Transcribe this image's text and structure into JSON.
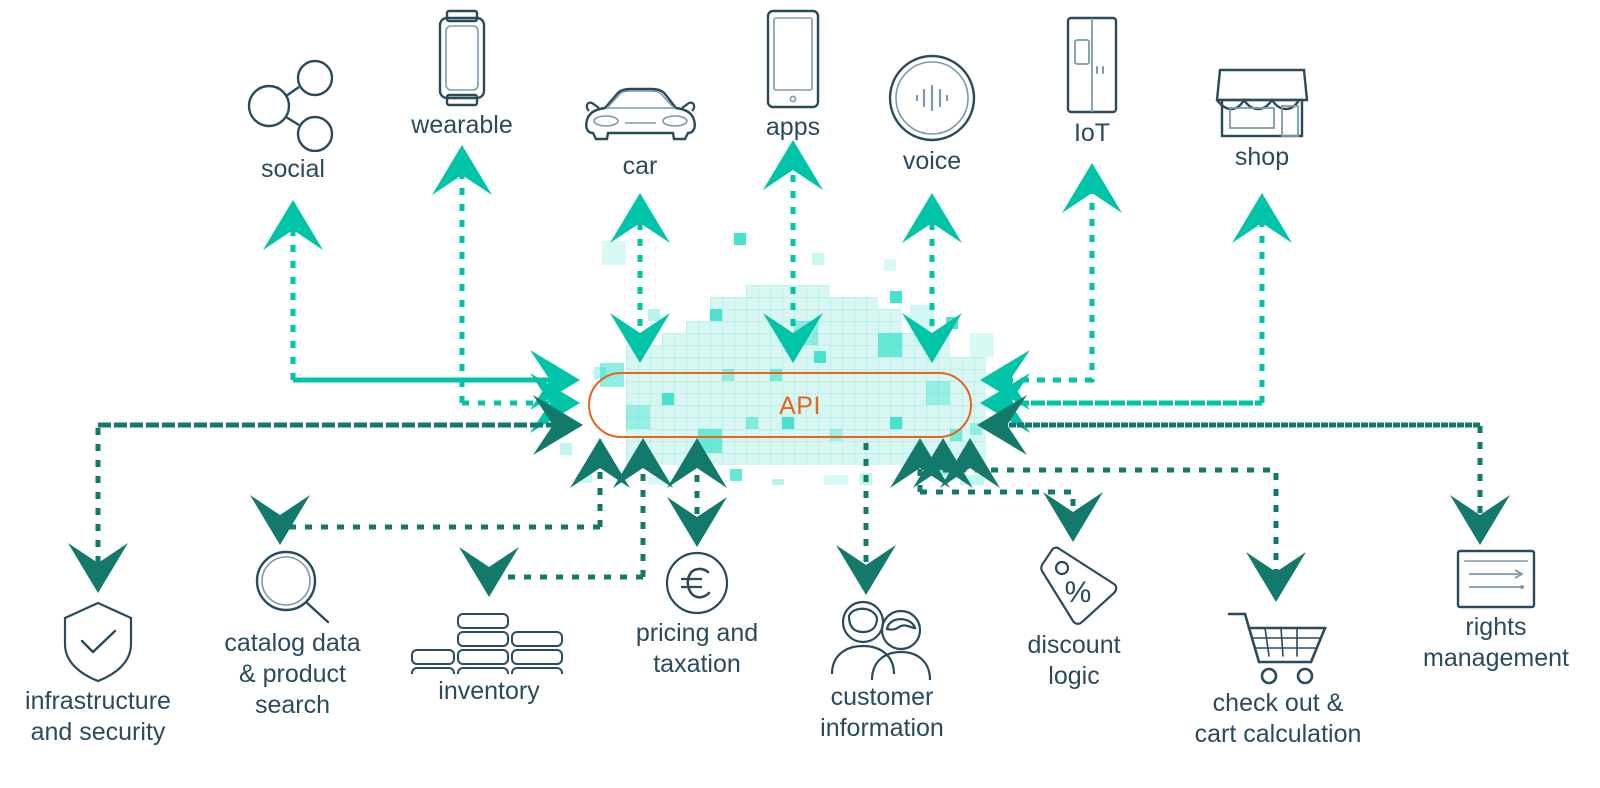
{
  "diagram": {
    "hub": {
      "label": "API",
      "accent": "#e8631c"
    },
    "colors": {
      "label_text": "#2a4a5e",
      "icon_stroke": "#2a4a5e",
      "arrow_top": "#00c4a7",
      "arrow_bottom": "#12796b",
      "cloud_fill": "#d9f7f2",
      "cloud_accent": "#2fe0c8"
    },
    "channels": [
      {
        "id": "social",
        "label": "social",
        "icon": "share-network-icon"
      },
      {
        "id": "wearable",
        "label": "wearable",
        "icon": "smartwatch-icon"
      },
      {
        "id": "car",
        "label": "car",
        "icon": "car-icon"
      },
      {
        "id": "apps",
        "label": "apps",
        "icon": "tablet-icon"
      },
      {
        "id": "voice",
        "label": "voice",
        "icon": "voice-assistant-icon"
      },
      {
        "id": "iot",
        "label": "IoT",
        "icon": "refrigerator-icon"
      },
      {
        "id": "shop",
        "label": "shop",
        "icon": "storefront-icon"
      }
    ],
    "services": [
      {
        "id": "infrastructure",
        "label": "infrastructure\nand security",
        "icon": "shield-check-icon"
      },
      {
        "id": "catalog",
        "label": "catalog data\n& product\nsearch",
        "icon": "magnifier-icon"
      },
      {
        "id": "inventory",
        "label": "inventory",
        "icon": "inventory-bars-icon"
      },
      {
        "id": "pricing",
        "label": "pricing and\ntaxation",
        "icon": "euro-coin-icon"
      },
      {
        "id": "customer",
        "label": "customer\ninformation",
        "icon": "two-people-icon"
      },
      {
        "id": "discount",
        "label": "discount\nlogic",
        "icon": "percent-tag-icon"
      },
      {
        "id": "checkout",
        "label": "check out &\ncart calculation",
        "icon": "shopping-cart-icon"
      },
      {
        "id": "rights",
        "label": "rights\nmanagement",
        "icon": "document-card-icon"
      }
    ]
  }
}
